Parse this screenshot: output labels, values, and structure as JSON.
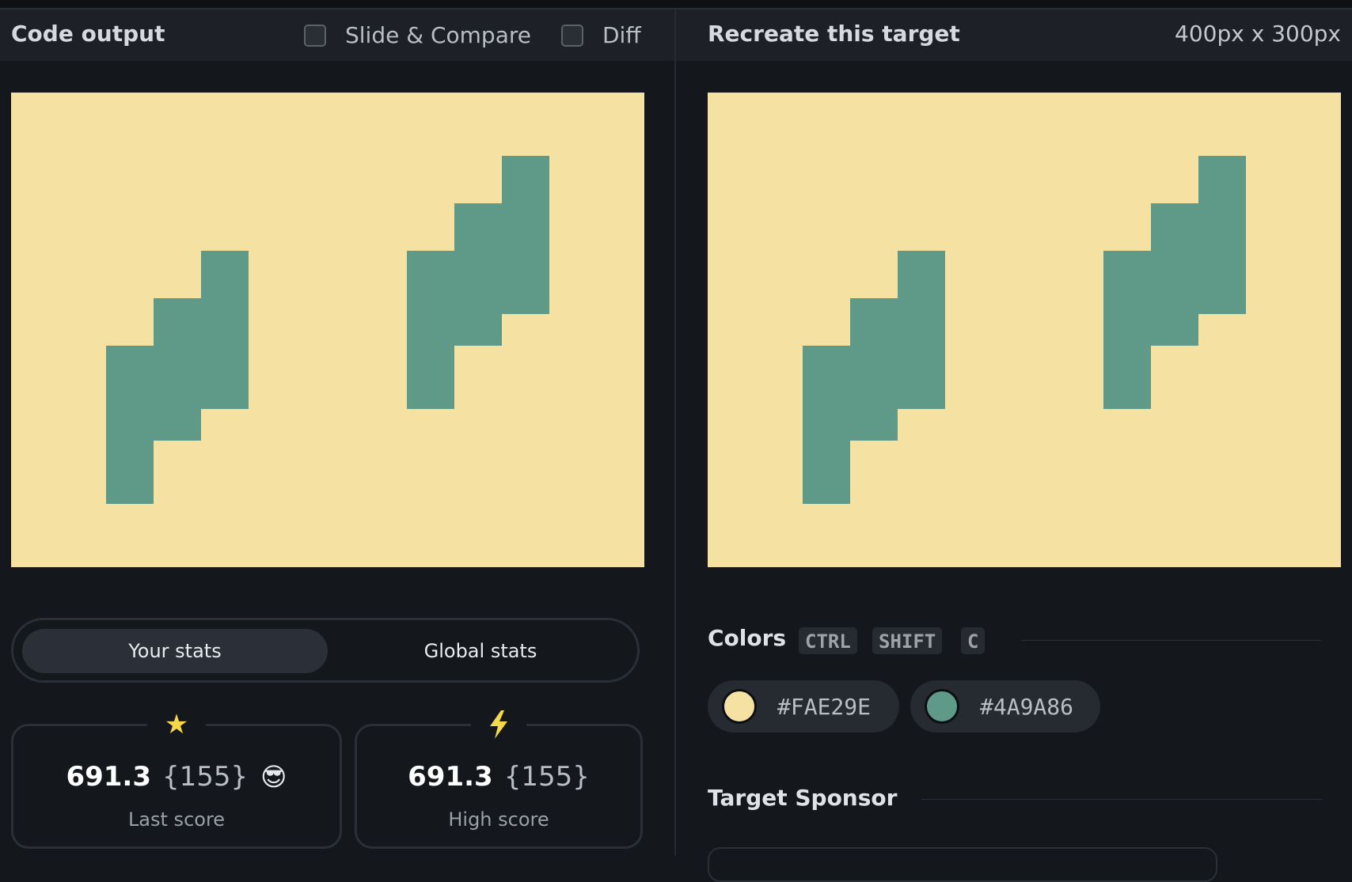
{
  "left_header": {
    "title": "Code output",
    "slide_compare_label": "Slide & Compare",
    "diff_label": "Diff"
  },
  "right_header": {
    "title": "Recreate this target",
    "dimensions": "400px x 300px"
  },
  "stats": {
    "tabs": [
      "Your stats",
      "Global stats"
    ],
    "active_tab": "Your stats",
    "last": {
      "icon": "star-icon",
      "value": "691.3",
      "count": "{155}",
      "emoji": "😎",
      "label": "Last score"
    },
    "high": {
      "icon": "lightning-icon",
      "value": "691.3",
      "count": "{155}",
      "label": "High score"
    }
  },
  "colors": {
    "title": "Colors",
    "shortcut_keys": [
      "CTRL",
      "SHIFT",
      "C"
    ],
    "swatches": [
      {
        "hex": "#FAE29E",
        "color": "#f5e2a3"
      },
      {
        "hex": "#4A9A86",
        "color": "#5f9a88"
      }
    ]
  },
  "sponsor": {
    "title": "Target Sponsor"
  },
  "palette": {
    "background": "#f5e2a3",
    "shape": "#5f9a88"
  }
}
